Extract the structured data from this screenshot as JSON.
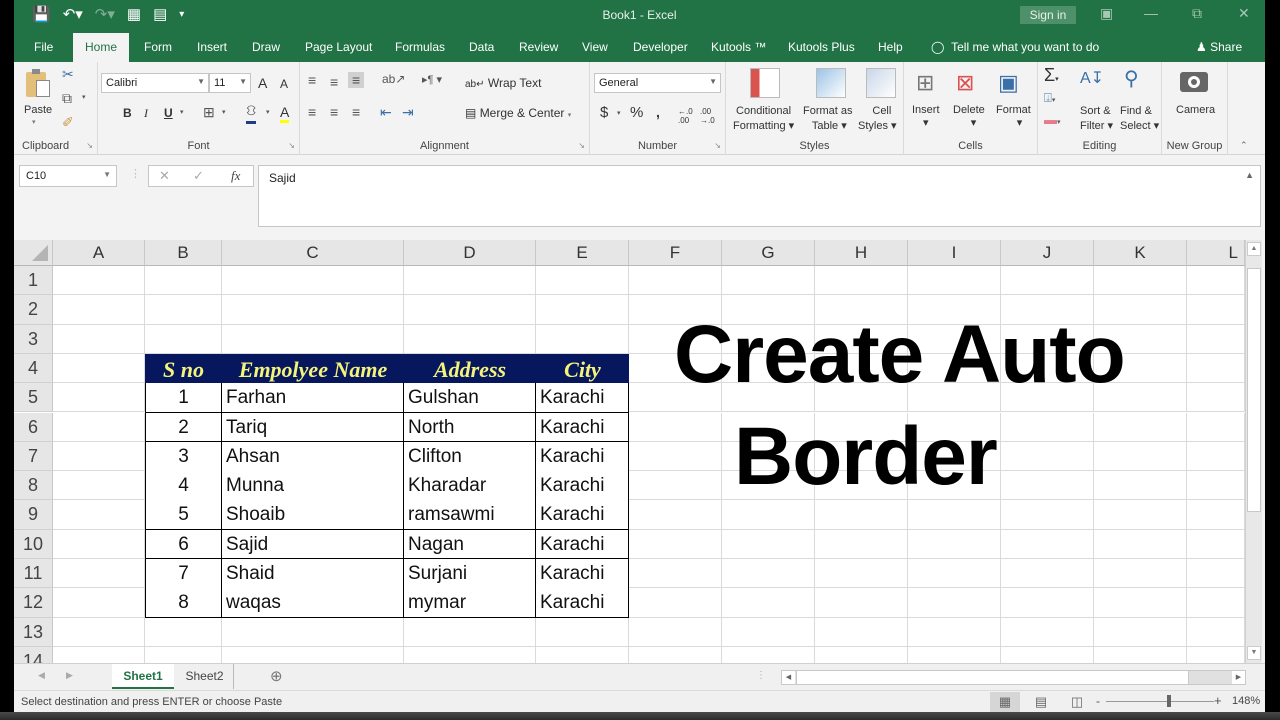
{
  "titlebar": {
    "title": "Book1  -  Excel",
    "sign_in": "Sign in",
    "qat_icons": [
      "save-icon",
      "undo-icon",
      "redo-icon",
      "form-icon",
      "camera-tool-icon",
      "customize-qat-icon"
    ]
  },
  "tabs": [
    "File",
    "Home",
    "Form",
    "Insert",
    "Draw",
    "Page Layout",
    "Formulas",
    "Data",
    "Review",
    "View",
    "Developer",
    "Kutools ™",
    "Kutools Plus",
    "Help"
  ],
  "active_tab": "Home",
  "tell_me": "Tell me what you want to do",
  "share": "Share",
  "ribbon": {
    "clipboard": {
      "label": "Clipboard",
      "paste": "Paste"
    },
    "font": {
      "label": "Font",
      "name": "Calibri",
      "size": "11",
      "bold": "B",
      "italic": "I",
      "underline": "U",
      "grow": "A",
      "shrink": "A",
      "fill_color": "#1f3b8a",
      "font_color": "#ffff00"
    },
    "alignment": {
      "label": "Alignment",
      "wrap_text": "Wrap Text",
      "merge_center": "Merge & Center"
    },
    "number": {
      "label": "Number",
      "format": "General",
      "currency": "$",
      "percent": "%",
      "comma": ",",
      "inc_decimal": ".0→.00",
      "dec_decimal": ".00→.0"
    },
    "styles": {
      "label": "Styles",
      "conditional_1": "Conditional",
      "conditional_2": "Formatting",
      "format_table_1": "Format as",
      "format_table_2": "Table",
      "cell_styles_1": "Cell",
      "cell_styles_2": "Styles"
    },
    "cells": {
      "label": "Cells",
      "insert": "Insert",
      "delete": "Delete",
      "format": "Format"
    },
    "editing": {
      "label": "Editing",
      "sort_1": "Sort &",
      "sort_2": "Filter",
      "find_1": "Find &",
      "find_2": "Select"
    },
    "new_group": {
      "label": "New Group",
      "camera": "Camera"
    }
  },
  "formula_bar": {
    "name_box": "C10",
    "cancel": "✕",
    "enter": "✓",
    "fx": "fx",
    "value": "Sajid"
  },
  "columns": [
    "A",
    "B",
    "C",
    "D",
    "E",
    "F",
    "G",
    "H",
    "I",
    "J",
    "K",
    "L"
  ],
  "rows": [
    "1",
    "2",
    "3",
    "4",
    "5",
    "6",
    "7",
    "8",
    "9",
    "10",
    "11",
    "12",
    "13",
    "14"
  ],
  "table": {
    "headers": [
      "S no",
      "Empolyee Name",
      "Address",
      "City"
    ],
    "header_bg": "#06175e",
    "header_fg": "#f4f47a",
    "rows": [
      [
        "1",
        "Farhan",
        "Gulshan",
        "Karachi"
      ],
      [
        "2",
        "Tariq",
        "North",
        "Karachi"
      ],
      [
        "3",
        "Ahsan",
        "Clifton",
        "Karachi"
      ],
      [
        "4",
        "Munna",
        "Kharadar",
        "Karachi"
      ],
      [
        "5",
        "Shoaib",
        "ramsawmi",
        "Karachi"
      ],
      [
        "6",
        "Sajid",
        "Nagan",
        "Karachi"
      ],
      [
        "7",
        "Shaid",
        "Surjani",
        "Karachi"
      ],
      [
        "8",
        "waqas",
        "mymar",
        "Karachi"
      ]
    ]
  },
  "overlay_title": {
    "line1": "Create Auto",
    "line2": "Border"
  },
  "sheets": [
    "Sheet1",
    "Sheet2"
  ],
  "active_sheet": "Sheet1",
  "status": {
    "message": "Select destination and press ENTER or choose Paste",
    "zoom": "148%",
    "zoom_minus": "-",
    "zoom_plus": "+"
  },
  "colors": {
    "brand": "#217346"
  }
}
